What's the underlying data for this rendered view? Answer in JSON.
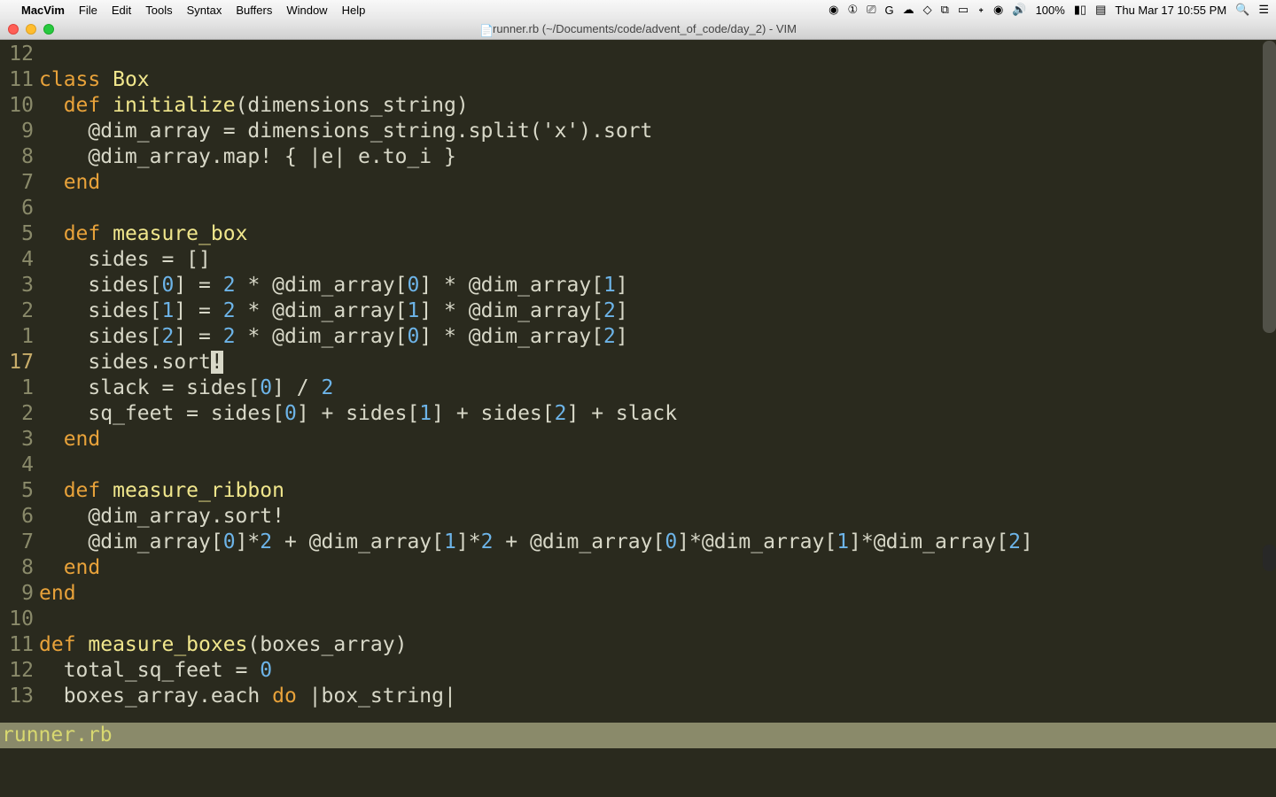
{
  "menubar": {
    "app": "MacVim",
    "items": [
      "File",
      "Edit",
      "Tools",
      "Syntax",
      "Buffers",
      "Window",
      "Help"
    ],
    "battery": "100%",
    "datetime": "Thu Mar 17  10:55 PM"
  },
  "window": {
    "title": "runner.rb (~/Documents/code/advent_of_code/day_2) - VIM"
  },
  "gutter": [
    {
      "n": "12",
      "type": "rel"
    },
    {
      "n": "11",
      "type": "rel"
    },
    {
      "n": "10",
      "type": "rel"
    },
    {
      "n": "9",
      "type": "rel"
    },
    {
      "n": "8",
      "type": "rel"
    },
    {
      "n": "7",
      "type": "rel"
    },
    {
      "n": "6",
      "type": "rel"
    },
    {
      "n": "5",
      "type": "rel"
    },
    {
      "n": "4",
      "type": "rel"
    },
    {
      "n": "3",
      "type": "rel"
    },
    {
      "n": "2",
      "type": "rel"
    },
    {
      "n": "1",
      "type": "rel"
    },
    {
      "n": "17",
      "type": "abs"
    },
    {
      "n": "1",
      "type": "rel"
    },
    {
      "n": "2",
      "type": "rel"
    },
    {
      "n": "3",
      "type": "rel"
    },
    {
      "n": "4",
      "type": "rel"
    },
    {
      "n": "5",
      "type": "rel"
    },
    {
      "n": "6",
      "type": "rel"
    },
    {
      "n": "7",
      "type": "rel"
    },
    {
      "n": "8",
      "type": "rel"
    },
    {
      "n": "9",
      "type": "rel"
    },
    {
      "n": "10",
      "type": "rel"
    },
    {
      "n": "11",
      "type": "rel"
    },
    {
      "n": "12",
      "type": "rel"
    },
    {
      "n": "13",
      "type": "rel"
    }
  ],
  "code": {
    "l0": "",
    "l1_a": "class",
    "l1_b": " Box",
    "l2_a": "  def",
    "l2_b": " initialize",
    "l2_c": "(dimensions_string)",
    "l3_a": "    @dim_array = dimensions_string.split(",
    "l3_b": "'x'",
    "l3_c": ").sort",
    "l4": "    @dim_array.map! { |e| e.to_i }",
    "l5": "  end",
    "l6": "",
    "l7_a": "  def",
    "l7_b": " measure_box",
    "l8": "    sides = []",
    "l9_a": "    sides[",
    "l9_b": "0",
    "l9_c": "] = ",
    "l9_d": "2",
    "l9_e": " * @dim_array[",
    "l9_f": "0",
    "l9_g": "] * @dim_array[",
    "l9_h": "1",
    "l9_i": "]",
    "l10_a": "    sides[",
    "l10_b": "1",
    "l10_c": "] = ",
    "l10_d": "2",
    "l10_e": " * @dim_array[",
    "l10_f": "1",
    "l10_g": "] * @dim_array[",
    "l10_h": "2",
    "l10_i": "]",
    "l11_a": "    sides[",
    "l11_b": "2",
    "l11_c": "] = ",
    "l11_d": "2",
    "l11_e": " * @dim_array[",
    "l11_f": "0",
    "l11_g": "] * @dim_array[",
    "l11_h": "2",
    "l11_i": "]",
    "l12_a": "    sides.sort",
    "l12_b": "!",
    "l13_a": "    slack = sides[",
    "l13_b": "0",
    "l13_c": "] / ",
    "l13_d": "2",
    "l14_a": "    sq_feet = sides[",
    "l14_b": "0",
    "l14_c": "] + sides[",
    "l14_d": "1",
    "l14_e": "] + sides[",
    "l14_f": "2",
    "l14_g": "] + slack",
    "l15": "  end",
    "l16": "",
    "l17_a": "  def",
    "l17_b": " measure_ribbon",
    "l18": "    @dim_array.sort!",
    "l19_a": "    @dim_array[",
    "l19_b": "0",
    "l19_c": "]*",
    "l19_d": "2",
    "l19_e": " + @dim_array[",
    "l19_f": "1",
    "l19_g": "]*",
    "l19_h": "2",
    "l19_i": " + @dim_array[",
    "l19_j": "0",
    "l19_k": "]*@dim_array[",
    "l19_l": "1",
    "l19_m": "]*@dim_array[",
    "l19_n": "2",
    "l19_o": "]",
    "l20": "  end",
    "l21": "end",
    "l22": "",
    "l23_a": "def",
    "l23_b": " measure_boxes",
    "l23_c": "(boxes_array)",
    "l24_a": "  total_sq_feet = ",
    "l24_b": "0",
    "l25_a": "  boxes_array.each ",
    "l25_b": "do",
    "l25_c": " |box_string|"
  },
  "statusbar": "runner.rb"
}
